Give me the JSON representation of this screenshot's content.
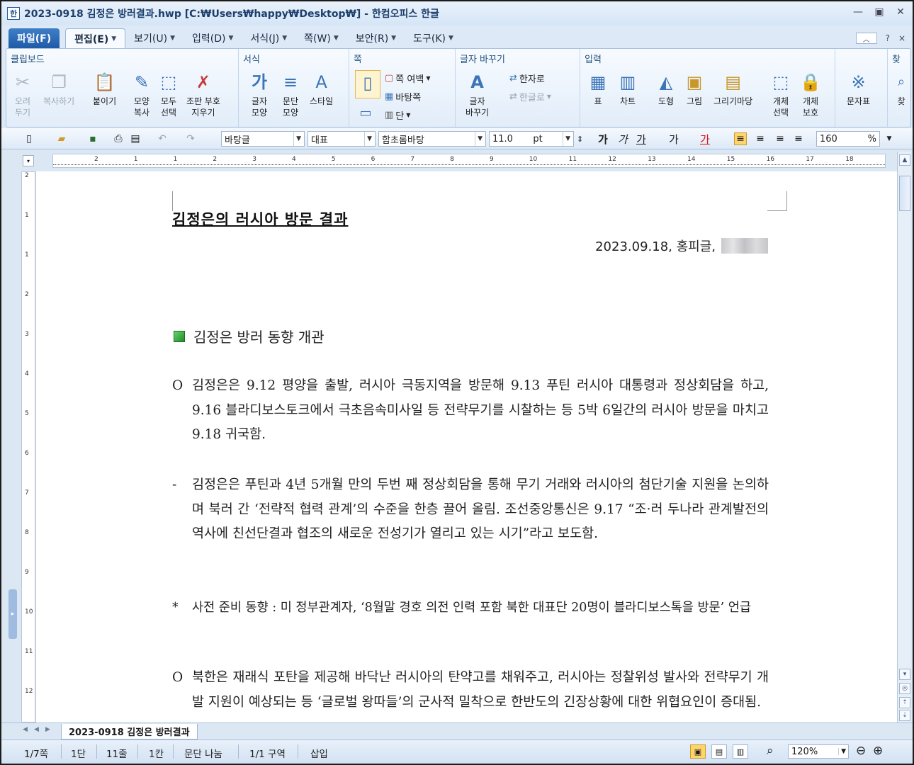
{
  "window": {
    "title": "2023-0918 김정은 방러결과.hwp [C:₩Users₩happy₩Desktop₩] - 한컴오피스 한글",
    "minimize": "▭",
    "restore": "▣",
    "close": "✕"
  },
  "menu": {
    "file": "파일(F)",
    "items": [
      "편집(E)",
      "보기(U)",
      "입력(D)",
      "서식(J)",
      "쪽(W)",
      "보안(R)",
      "도구(K)"
    ],
    "help": "?",
    "close": "×"
  },
  "ribbon": {
    "groups": {
      "clipboard": "클립보드",
      "format": "서식",
      "page": "쪽",
      "convert": "글자 바꾸기",
      "insert": "입력",
      "find": "찾"
    },
    "buttons": {
      "cut": "오려\n두기",
      "copy": "복사하기",
      "paste": "붙이기",
      "shape_copy": "모양\n복사",
      "select_all": "모두\n선택",
      "erase_marks": "조판 부호\n지우기",
      "char_shape": "글자\n모양",
      "para_shape": "문단\n모양",
      "style": "스타일",
      "page_margin": "쪽 여백",
      "background_page": "바탕쪽",
      "columns": "단",
      "convert_char": "글자\n바꾸기",
      "to_hanja": "한자로",
      "to_hangul": "한글로",
      "table": "표",
      "chart": "차트",
      "shape": "도형",
      "picture": "그림",
      "drawing_gallery": "그리기마당",
      "object_select": "개체\n선택",
      "object_protect": "개체\n보호",
      "symbols": "문자표",
      "find": "찾"
    }
  },
  "toolbar": {
    "style": "바탕글",
    "lang": "대표",
    "font": "함초롬바탕",
    "size": "11.0",
    "size_unit": "pt",
    "bold": "가",
    "italic": "가",
    "underline": "가",
    "strike": "가",
    "color": "가",
    "line_spacing": "160",
    "percent": "%"
  },
  "ruler": {
    "h_ticks": [
      "2",
      "1",
      "1",
      "2",
      "3",
      "4",
      "5",
      "6",
      "7",
      "8",
      "9",
      "10",
      "11",
      "12",
      "13",
      "14",
      "15",
      "16",
      "17",
      "18"
    ],
    "v_ticks": [
      "2",
      "1",
      "1",
      "2",
      "3",
      "4",
      "5",
      "6",
      "7",
      "8",
      "9",
      "10",
      "11",
      "12"
    ]
  },
  "document": {
    "title": "김정은의 러시아 방문 결과",
    "byline": "2023.09.18, 홍피글,",
    "heading": "김정은 방러 동향 개관",
    "paragraphs": [
      {
        "bullet": "O",
        "text": "김정은은 9.12 평양을 출발, 러시아 극동지역을 방문해 9.13 푸틴 러시아 대통령과 정상회담을 하고, 9.16 블라디보스토크에서 극초음속미사일 등 전략무기를 시찰하는 등 5박 6일간의 러시아 방문을 마치고 9.18 귀국함."
      },
      {
        "bullet": "-",
        "text": "김정은은 푸틴과 4년 5개월 만의 두번 째 정상회담을 통해 무기 거래와 러시아의 첨단기술 지원을 논의하며 북러 간 ‘전략적 협력 관계’의 수준을 한층 끌어 올림. 조선중앙통신은 9.17 “조·러 두나라 관계발전의 역사에 친선단결과 협조의 새로운 전성기가 열리고 있는 시기”라고 보도함."
      },
      {
        "bullet": "*",
        "text": "사전 준비 동향 : 미 정부관계자, ‘8월말 경호 의전 인력 포함 북한 대표단 20명이 블라디보스톡을 방문’ 언급"
      },
      {
        "bullet": "O",
        "text": "북한은 재래식 포탄을 제공해 바닥난 러시아의 탄약고를 채워주고, 러시아는 정찰위성 발사와 전략무기 개발 지원이 예상되는 등 ‘글로벌 왕따들’의 군사적 밀착으로 한반도의 긴장상황에 대한 위협요인이 증대됨."
      }
    ]
  },
  "tab": {
    "name": "2023-0918 김정은 방러결과"
  },
  "status": {
    "page": "1/7쪽",
    "column": "1단",
    "line": "11줄",
    "char": "1칸",
    "section_break": "문단 나눔",
    "section": "1/1 구역",
    "mode": "삽입",
    "zoom": "120%"
  }
}
